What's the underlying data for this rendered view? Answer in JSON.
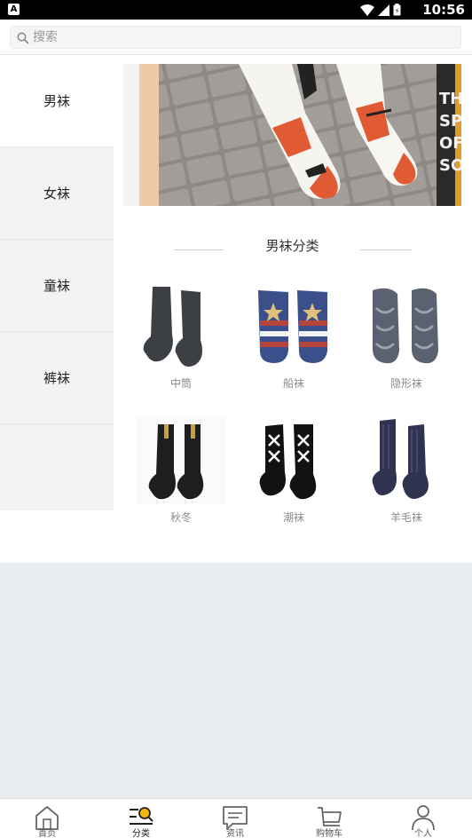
{
  "status_bar": {
    "time": "10:56",
    "app_badge": "A"
  },
  "search": {
    "placeholder": "搜索",
    "icon": "search-icon"
  },
  "sidebar": {
    "items": [
      {
        "label": "男袜",
        "active": true
      },
      {
        "label": "女袜",
        "active": false
      },
      {
        "label": "童袜",
        "active": false
      },
      {
        "label": "裤袜",
        "active": false
      }
    ]
  },
  "banner": {
    "overlay_text": "THE SP OF SOC"
  },
  "section": {
    "title": "男袜分类"
  },
  "categories": [
    {
      "label": "中筒",
      "color": "#3c3f44"
    },
    {
      "label": "船袜",
      "color": "#3b4f8a"
    },
    {
      "label": "隐形袜",
      "color": "#5a6272"
    },
    {
      "label": "秋冬",
      "color": "#1e1e1e"
    },
    {
      "label": "潮袜",
      "color": "#121212"
    },
    {
      "label": "羊毛袜",
      "color": "#2f3350"
    }
  ],
  "tabbar": {
    "tabs": [
      {
        "label": "首页",
        "icon": "home-icon",
        "active": false
      },
      {
        "label": "分类",
        "icon": "category-search-icon",
        "active": true
      },
      {
        "label": "资讯",
        "icon": "news-icon",
        "active": false
      },
      {
        "label": "购物车",
        "icon": "cart-icon",
        "active": false
      },
      {
        "label": "个人",
        "icon": "user-icon",
        "active": false
      }
    ]
  },
  "colors": {
    "accent": "#f2b705",
    "sidebar_bg": "#f2f3f5",
    "page_bg": "#e9ecef"
  }
}
